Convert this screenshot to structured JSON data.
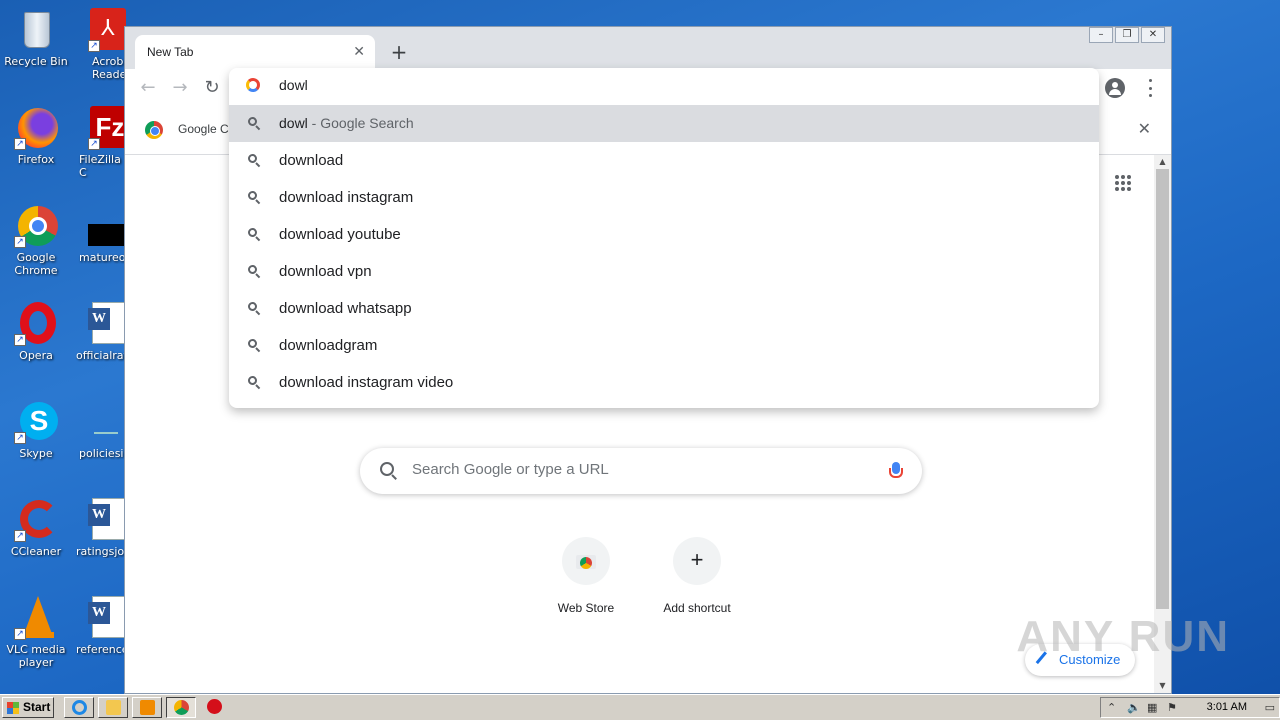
{
  "desktop": {
    "icons": [
      {
        "label": "Recycle Bin",
        "icon": "recycle-bin-icon"
      },
      {
        "label": "Acrobat Reader",
        "icon": "acrobat-reader-icon"
      },
      {
        "label": "Firefox",
        "icon": "firefox-icon"
      },
      {
        "label": "FileZilla C",
        "icon": "filezilla-icon"
      },
      {
        "label": "Google Chrome",
        "icon": "chrome-icon"
      },
      {
        "label": "matureof",
        "icon": "file-icon"
      },
      {
        "label": "Opera",
        "icon": "opera-icon"
      },
      {
        "label": "officialrat",
        "icon": "word-document-icon"
      },
      {
        "label": "Skype",
        "icon": "skype-icon"
      },
      {
        "label": "policiesin",
        "icon": "file-icon"
      },
      {
        "label": "CCleaner",
        "icon": "ccleaner-icon"
      },
      {
        "label": "ratingsjoh",
        "icon": "word-document-icon"
      },
      {
        "label": "VLC media player",
        "icon": "vlc-icon"
      },
      {
        "label": "reference",
        "icon": "word-document-icon"
      }
    ]
  },
  "browser": {
    "tab_title": "New Tab",
    "tab_close": "✕",
    "new_tab": "+",
    "infobar_text": "Google Cl",
    "infobar_close": "✕",
    "window_controls": {
      "minimize": "–",
      "restore": "❐",
      "close": "✕"
    },
    "nav": {
      "back": "←",
      "forward": "→",
      "reload": "↻"
    }
  },
  "omnibox": {
    "typed": "dowl",
    "suggestions": [
      {
        "bold": "dowl",
        "sub": " - Google Search"
      },
      {
        "bold": "download",
        "sub": ""
      },
      {
        "bold": "download instagram",
        "sub": ""
      },
      {
        "bold": "download youtube",
        "sub": ""
      },
      {
        "bold": "download vpn",
        "sub": ""
      },
      {
        "bold": "download whatsapp",
        "sub": ""
      },
      {
        "bold": "downloadgram",
        "sub": ""
      },
      {
        "bold": "download instagram video",
        "sub": ""
      }
    ]
  },
  "newtab": {
    "search_placeholder": "Search Google or type a URL",
    "shortcuts": [
      {
        "label": "Web Store"
      },
      {
        "label": "Add shortcut",
        "glyph": "+"
      }
    ],
    "customize": "Customize"
  },
  "watermark": "ANY RUN",
  "taskbar": {
    "start": "Start",
    "clock": "3:01 AM"
  },
  "colors": {
    "desktop_bg": "#1d68c4",
    "accent": "#1a73e8",
    "selected_row": "#dadce0"
  }
}
